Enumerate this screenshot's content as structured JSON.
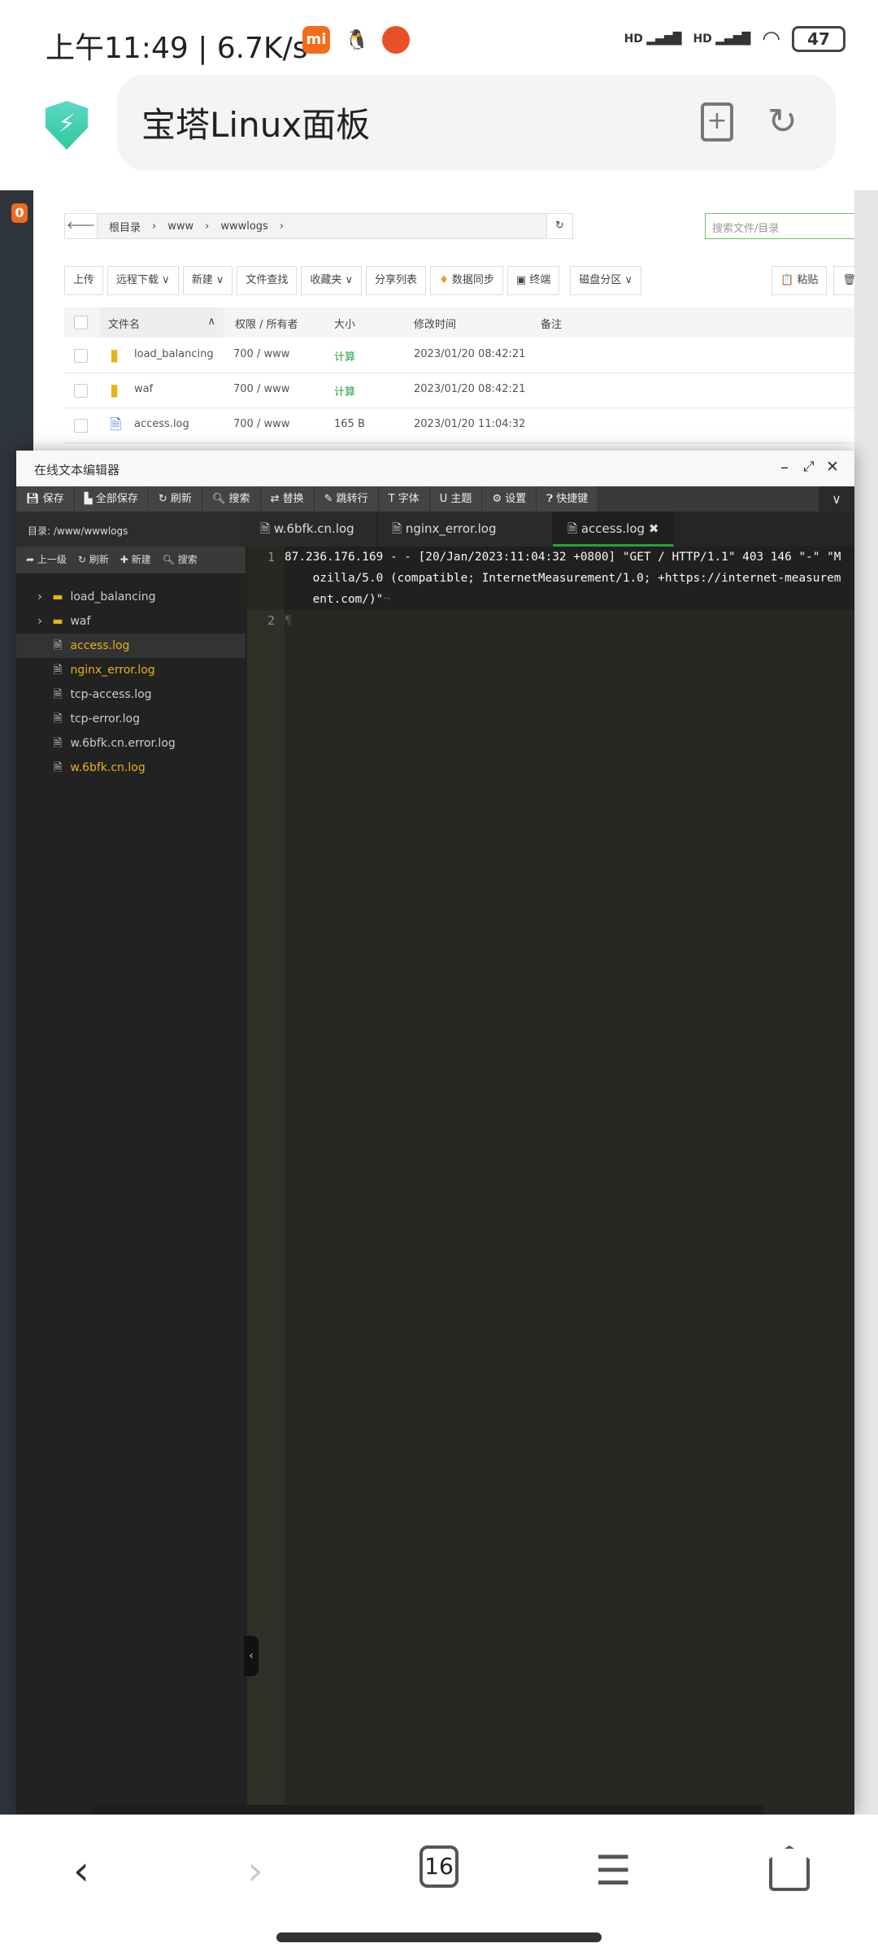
{
  "status_bar": {
    "time": "上午11:49",
    "speed": "6.7K/s",
    "signal1": "HD",
    "signal2": "HD",
    "battery": "47",
    "icons": [
      "mi-icon",
      "qq-icon",
      "app-icon",
      "signal-icon",
      "signal-icon",
      "wifi-icon",
      "battery-icon"
    ]
  },
  "browser": {
    "title": "宝塔Linux面板",
    "tab_count": "16"
  },
  "sidebar": {
    "badge": "0"
  },
  "file_manager": {
    "breadcrumb": [
      "根目录",
      "www",
      "wwwlogs"
    ],
    "search_placeholder": "搜索文件/目录",
    "toolbar": [
      "上传",
      "远程下载",
      "新建",
      "文件查找",
      "收藏夹",
      "分享列表",
      "数据同步",
      "终端",
      "磁盘分区"
    ],
    "toolbar_right": [
      "粘贴",
      "回收"
    ],
    "columns": [
      "文件名",
      "权限 / 所有者",
      "大小",
      "修改时间",
      "备注"
    ],
    "rows": [
      {
        "name": "load_balancing",
        "perm": "700 / www",
        "size": "计算",
        "mtime": "2023/01/20 08:42:21",
        "type": "folder"
      },
      {
        "name": "waf",
        "perm": "700 / www",
        "size": "计算",
        "mtime": "2023/01/20 08:42:21",
        "type": "folder"
      },
      {
        "name": "access.log",
        "perm": "700 / www",
        "size": "165 B",
        "mtime": "2023/01/20 11:04:32",
        "type": "file"
      }
    ]
  },
  "editor": {
    "title": "在线文本编辑器",
    "toolbar": [
      "保存",
      "全部保存",
      "刷新",
      "搜索",
      "替换",
      "跳转行",
      "字体",
      "主题",
      "设置",
      "快捷键"
    ],
    "dir_label": "目录: /www/wwwlogs",
    "sub_toolbar": [
      "上一级",
      "刷新",
      "新建",
      "搜索"
    ],
    "tree": [
      {
        "name": "load_balancing",
        "type": "folder",
        "highlight": false
      },
      {
        "name": "waf",
        "type": "folder",
        "highlight": false
      },
      {
        "name": "access.log",
        "type": "file",
        "highlight": true,
        "selected": true
      },
      {
        "name": "nginx_error.log",
        "type": "file",
        "highlight": true
      },
      {
        "name": "tcp-access.log",
        "type": "file",
        "highlight": false
      },
      {
        "name": "tcp-error.log",
        "type": "file",
        "highlight": false
      },
      {
        "name": "w.6bfk.cn.error.log",
        "type": "file",
        "highlight": false
      },
      {
        "name": "w.6bfk.cn.log",
        "type": "file",
        "highlight": true
      }
    ],
    "tabs": [
      "w.6bfk.cn.log",
      "nginx_error.log",
      "access.log"
    ],
    "active_tab": "access.log",
    "lines": [
      "1",
      "2"
    ],
    "code": [
      "87.236.176.169 - - [20/Jan/2023:11:04:32 +0800] \"GET / HTTP/1.1\" 403 146 \"-\" \"Mozilla/5.0 (compatible; InternetMeasurement/1.0; +https://internet-measurement.com/)\"",
      ""
    ]
  },
  "colors": {
    "accent": "#20a53a",
    "highlight_file": "#e4b418",
    "editor_bg": "#272822"
  }
}
